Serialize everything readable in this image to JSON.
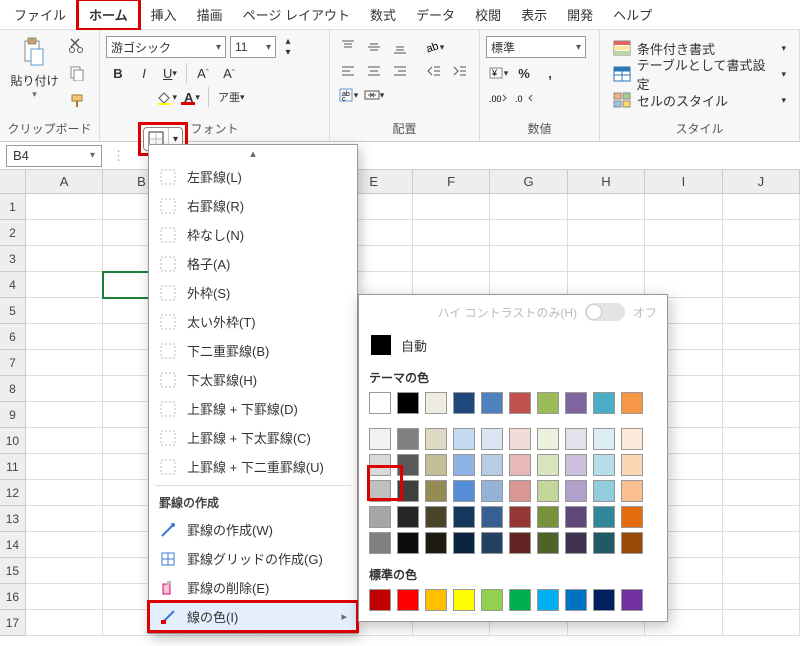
{
  "menubar": {
    "tabs": [
      "ファイル",
      "ホーム",
      "挿入",
      "描画",
      "ページ レイアウト",
      "数式",
      "データ",
      "校閲",
      "表示",
      "開発",
      "ヘルプ"
    ],
    "active_index": 1
  },
  "ribbon": {
    "clipboard": {
      "label": "クリップボード",
      "paste": "貼り付け"
    },
    "font": {
      "label": "フォント",
      "name": "游ゴシック",
      "size": "11",
      "ruby": "ア亜"
    },
    "alignment": {
      "label": "配置"
    },
    "number": {
      "label": "数値",
      "format": "標準"
    },
    "styles": {
      "label": "スタイル",
      "conditional": "条件付き書式",
      "table": "テーブルとして書式設定",
      "cell": "セルのスタイル"
    }
  },
  "namebox": {
    "value": "B4"
  },
  "columns": [
    "A",
    "B",
    "C",
    "D",
    "E",
    "F",
    "G",
    "H",
    "I",
    "J"
  ],
  "row_count": 17,
  "active_cell": {
    "row": 4,
    "col": 1
  },
  "border_menu": {
    "items_top": [
      {
        "label": "左罫線(L)"
      },
      {
        "label": "右罫線(R)"
      },
      {
        "label": "枠なし(N)"
      },
      {
        "label": "格子(A)"
      },
      {
        "label": "外枠(S)"
      },
      {
        "label": "太い外枠(T)"
      },
      {
        "label": "下二重罫線(B)"
      },
      {
        "label": "下太罫線(H)"
      },
      {
        "label": "上罫線 + 下罫線(D)"
      },
      {
        "label": "上罫線 + 下太罫線(C)"
      },
      {
        "label": "上罫線 + 下二重罫線(U)"
      }
    ],
    "section": "罫線の作成",
    "items_draw": [
      {
        "label": "罫線の作成(W)"
      },
      {
        "label": "罫線グリッドの作成(G)"
      },
      {
        "label": "罫線の削除(E)"
      },
      {
        "label": "線の色(I)",
        "submenu": true,
        "hovered": true
      }
    ]
  },
  "color_flyout": {
    "high_contrast": "ハイ コントラストのみ(H)",
    "toggle_text": "オフ",
    "auto": "自動",
    "theme_label": "テーマの色",
    "standard_label": "標準の色",
    "theme_base": [
      "#ffffff",
      "#000000",
      "#eeece1",
      "#1f497d",
      "#4f81bd",
      "#c0504d",
      "#9bbb59",
      "#8064a2",
      "#4bacc6",
      "#f79646"
    ],
    "theme_shades": [
      [
        "#f2f2f2",
        "#7f7f7f",
        "#ddd9c4",
        "#c5d9f1",
        "#dbe5f1",
        "#f2dcdb",
        "#ebf1de",
        "#e5e0ec",
        "#daeef3",
        "#fdeada"
      ],
      [
        "#d9d9d9",
        "#595959",
        "#c4bd97",
        "#8eb4e3",
        "#b8cce4",
        "#e6b9b8",
        "#d7e4bd",
        "#ccc0da",
        "#b7dde8",
        "#fcd5b4"
      ],
      [
        "#bfbfbf",
        "#3f3f3f",
        "#948a54",
        "#538dd5",
        "#95b3d7",
        "#da9694",
        "#c4d79b",
        "#b1a0c7",
        "#92cddc",
        "#fabf8f"
      ],
      [
        "#a6a6a6",
        "#262626",
        "#4a452a",
        "#16365d",
        "#376092",
        "#963634",
        "#76933c",
        "#60497a",
        "#31869b",
        "#e46c0a"
      ],
      [
        "#808080",
        "#0d0d0d",
        "#1e1c11",
        "#0a233e",
        "#244062",
        "#632523",
        "#4f6228",
        "#403151",
        "#215967",
        "#984807"
      ]
    ],
    "standard": [
      "#c00000",
      "#ff0000",
      "#ffc000",
      "#ffff00",
      "#92d050",
      "#00b050",
      "#00b0f0",
      "#0070c0",
      "#002060",
      "#7030a0"
    ]
  }
}
